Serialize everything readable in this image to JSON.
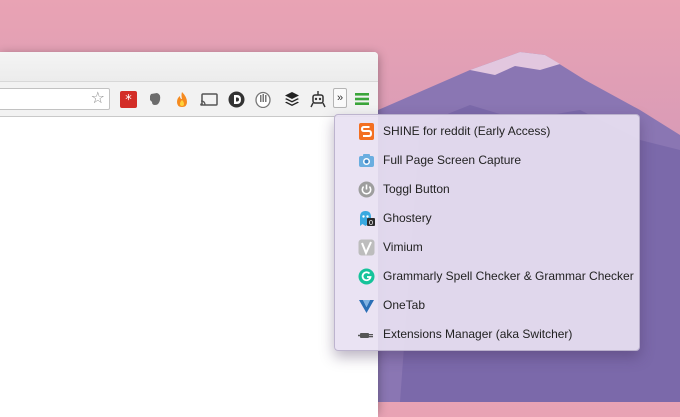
{
  "browser": {
    "toolbar": {
      "extensions": [
        {
          "icon": "lastpass-icon"
        },
        {
          "icon": "evernote-icon"
        },
        {
          "icon": "shine-fire-icon"
        },
        {
          "icon": "cast-icon"
        },
        {
          "icon": "disconnect-icon"
        },
        {
          "icon": "toggl-hand-icon"
        },
        {
          "icon": "buffer-stack-icon"
        },
        {
          "icon": "robot-icon"
        }
      ],
      "overflow_label": "»",
      "menu_icon": "hamburger-menu-icon"
    }
  },
  "menu": {
    "items": [
      {
        "label": "SHINE for reddit (Early Access)",
        "icon": "shine-icon",
        "color": "#f36f21"
      },
      {
        "label": "Full Page Screen Capture",
        "icon": "camera-icon",
        "color": "#5aa0d8"
      },
      {
        "label": "Toggl Button",
        "icon": "power-icon",
        "color": "#9a9a9a"
      },
      {
        "label": "Ghostery",
        "icon": "ghost-icon",
        "color": "#39a9e0"
      },
      {
        "label": "Vimium",
        "icon": "vimium-icon",
        "color": "#b0b0b0"
      },
      {
        "label": "Grammarly Spell Checker & Grammar Checker",
        "icon": "grammarly-icon",
        "color": "#15c39a"
      },
      {
        "label": "OneTab",
        "icon": "onetab-icon",
        "color": "#2a6fb6"
      },
      {
        "label": "Extensions Manager (aka Switcher)",
        "icon": "plug-icon",
        "color": "#555555"
      }
    ]
  }
}
